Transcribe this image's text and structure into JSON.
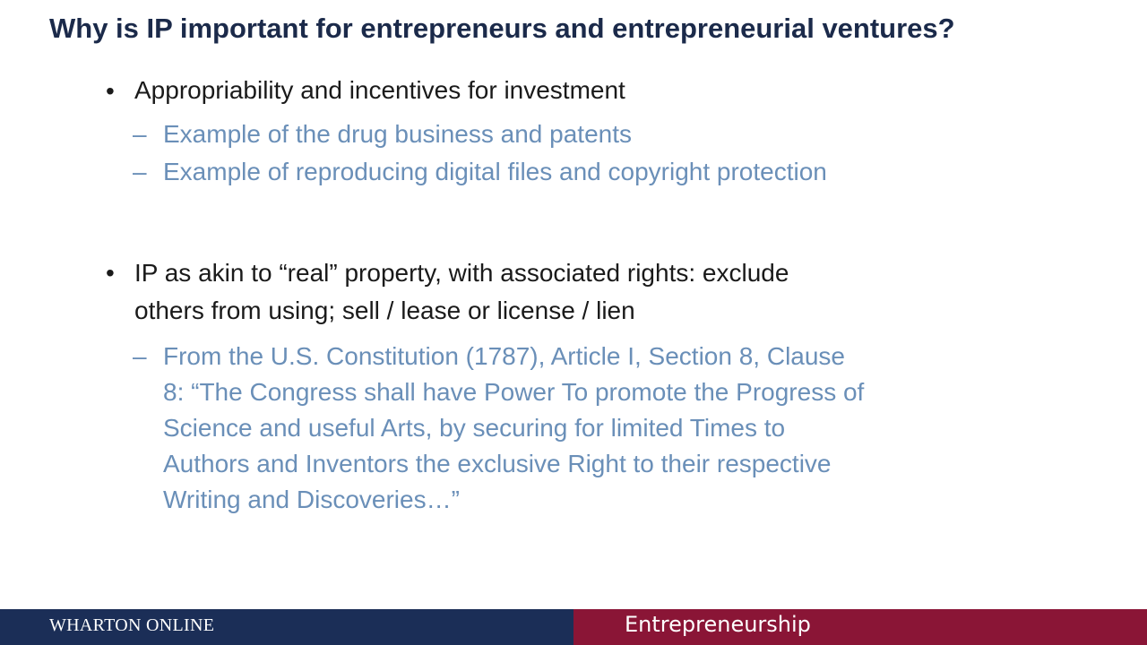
{
  "slide": {
    "title": "Why is IP important for entrepreneurs and entrepreneurial ventures?",
    "bullets": [
      {
        "marker": "•",
        "lines": [
          "Appropriability and incentives for investment"
        ],
        "subs": [
          {
            "marker": "–",
            "lines": [
              "Example of the drug business and patents"
            ]
          },
          {
            "marker": "–",
            "lines": [
              "Example of reproducing digital files and copyright protection"
            ]
          }
        ]
      },
      {
        "marker": "•",
        "lines": [
          "IP as akin to “real” property, with associated rights: exclude",
          "others from using; sell / lease or license / lien"
        ],
        "subs": [
          {
            "marker": "–",
            "lines": [
              "From the U.S. Constitution (1787), Article I, Section 8, Clause",
              "8: “The Congress shall have Power To promote the Progress of",
              "Science and useful Arts, by securing for limited Times to",
              "Authors and Inventors the exclusive Right to their respective",
              "Writing and Discoveries…”"
            ]
          }
        ]
      }
    ]
  },
  "footer": {
    "brand": "WHARTON ONLINE",
    "course": "Entrepreneurship"
  },
  "colors": {
    "title": "#1b2a4a",
    "body_text": "#1a1a1a",
    "sub_text": "#6a8fb8",
    "footer_left": "#1b2e57",
    "footer_right": "#8a1536"
  }
}
